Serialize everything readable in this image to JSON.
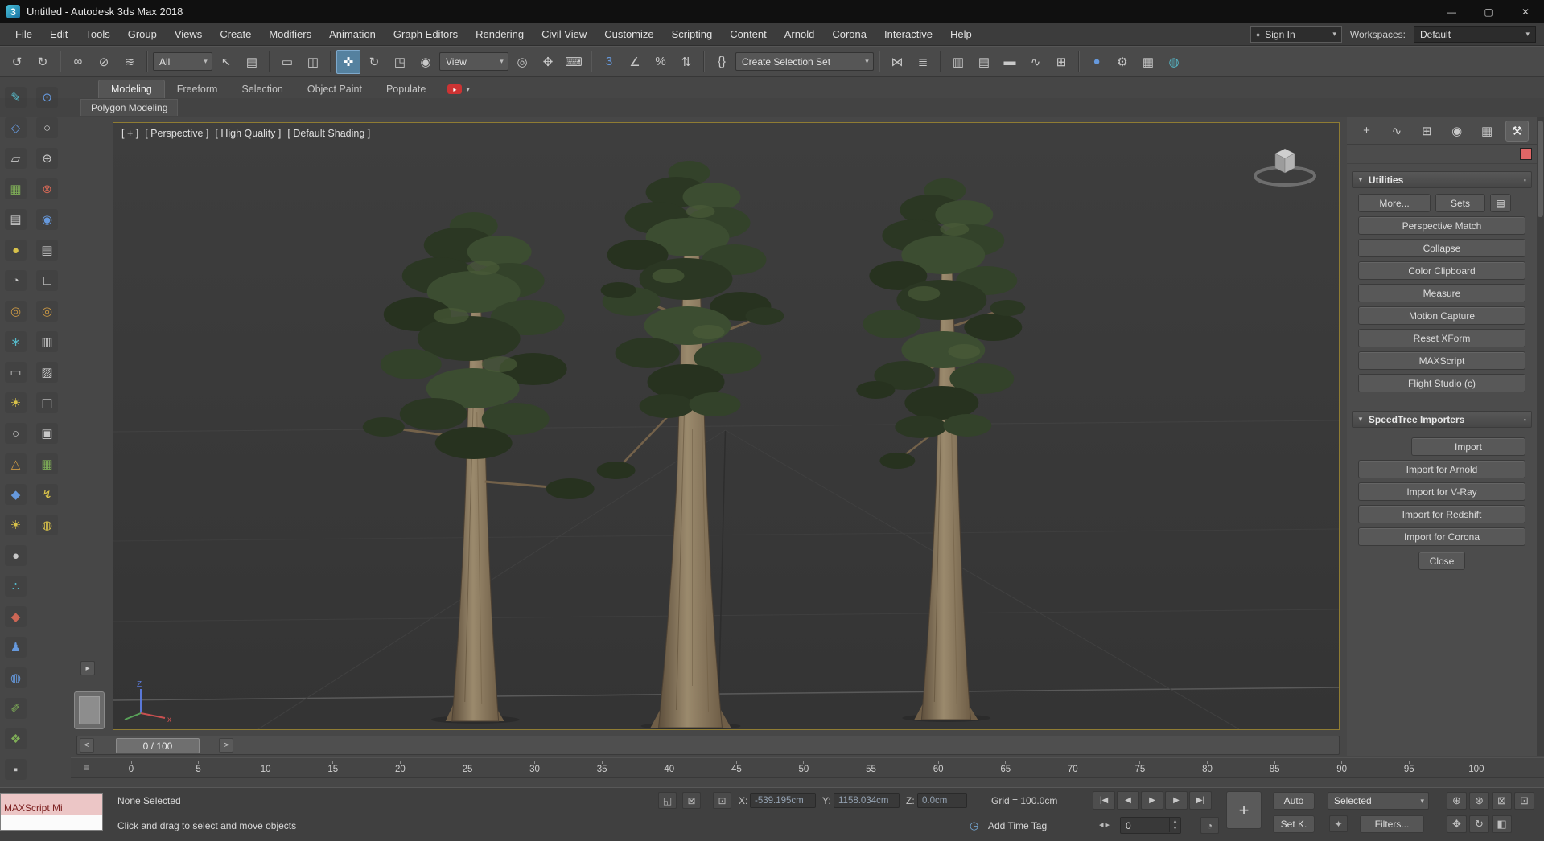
{
  "ui": {
    "caret": "▾",
    "spin_up": "▴",
    "spin_down": "▾",
    "slider_prev": "<",
    "slider_next": ">",
    "flyout": "▸",
    "ruler_icon": "≡",
    "rollout_open": "▼",
    "rollout_grip": "▪",
    "minimize": "—",
    "maximize": "▢",
    "close": "✕",
    "user": "●",
    "play": "▸",
    "logo": "3",
    "plus": "+"
  },
  "window": {
    "title": "Untitled - Autodesk 3ds Max 2018"
  },
  "menubar": {
    "items": [
      "File",
      "Edit",
      "Tools",
      "Group",
      "Views",
      "Create",
      "Modifiers",
      "Animation",
      "Graph Editors",
      "Rendering",
      "Civil View",
      "Customize",
      "Scripting",
      "Content",
      "Arnold",
      "Corona",
      "Interactive",
      "Help"
    ],
    "sign_in": "Sign In",
    "workspaces_label": "Workspaces:",
    "workspace_value": "Default"
  },
  "toolbar": {
    "filter_value": "All",
    "view_value": "View",
    "selection_set_placeholder": "Create Selection Set",
    "icons": [
      "↺",
      "↻",
      "∞",
      "⊘",
      "≋",
      "↖",
      "▤",
      "▭",
      "◫",
      "✜",
      "↻",
      "◳",
      "◉",
      "◎",
      "✥",
      "⌨",
      "3",
      "∠",
      "%",
      "⇅",
      "{}",
      "⋈",
      "≣",
      "▥",
      "▤",
      "▬",
      "∿",
      "⊞",
      "●",
      "⚙",
      "▦",
      "◍"
    ]
  },
  "ribbon": {
    "tabs": [
      "Modeling",
      "Freeform",
      "Selection",
      "Object Paint",
      "Populate"
    ],
    "sub_tab": "Polygon Modeling"
  },
  "left_toolbar": {
    "column_a": [
      "✎",
      "◇",
      "▱",
      "▦",
      "▤",
      "●",
      "◔",
      "◎",
      "∗",
      "▭",
      "☀",
      "○",
      "△",
      "◆",
      "☀",
      "●",
      "∴",
      "◆",
      "♟",
      "◍",
      "✐",
      "❖",
      "▪"
    ],
    "column_b": [
      "⊙",
      "○",
      "⊕",
      "⊗",
      "◉",
      "▤",
      "∟",
      "◎",
      "▥",
      "▨",
      "◫",
      "▣",
      "▦",
      "↯",
      "◍"
    ]
  },
  "viewport": {
    "segments": [
      "[ + ]",
      "[ Perspective ]",
      "[ High Quality ]",
      "[ Default Shading ]"
    ],
    "axis_x": "x",
    "axis_z": "Z"
  },
  "command_panel": {
    "tabs": [
      "+",
      "∿",
      "⊞",
      "◉",
      "▦",
      "⚒"
    ],
    "swatch_style": "background:#e06666",
    "utilities": {
      "title": "Utilities",
      "more": "More...",
      "sets": "Sets",
      "sets_icon": "▤",
      "buttons": [
        "Perspective Match",
        "Collapse",
        "Color Clipboard",
        "Measure",
        "Motion Capture",
        "Reset XForm",
        "MAXScript",
        "Flight Studio (c)"
      ]
    },
    "speedtree": {
      "title": "SpeedTree Importers",
      "import": "Import",
      "buttons": [
        "Import for Arnold",
        "Import for V-Ray",
        "Import for Redshift",
        "Import for Corona"
      ],
      "close": "Close"
    }
  },
  "timeline": {
    "frame_display": "0 / 100",
    "ticks": [
      "0",
      "5",
      "10",
      "15",
      "20",
      "25",
      "30",
      "35",
      "40",
      "45",
      "50",
      "55",
      "60",
      "65",
      "70",
      "75",
      "80",
      "85",
      "90",
      "95",
      "100"
    ]
  },
  "status": {
    "maxscript_label": "MAXScript Mi",
    "selection": "None Selected",
    "prompt": "Click and drag to select and move objects",
    "x_label": "X:",
    "x_value": "-539.195cm",
    "y_label": "Y:",
    "y_value": "1158.034cm",
    "z_label": "Z:",
    "z_value": "0.0cm",
    "grid_label": "Grid = 100.0cm",
    "add_time_tag": "Add Time Tag",
    "auto_key": "Auto",
    "selected": "Selected",
    "set_key": "Set K.",
    "filters": "Filters...",
    "frame_value": "0",
    "playback": [
      "|◀",
      "◀",
      "▶",
      "▶",
      "▶|"
    ],
    "nav_row1": [
      "⊕",
      "⊛",
      "⊠",
      "⊡"
    ],
    "nav_row2": [
      "✥",
      "↻",
      "◧"
    ],
    "icons": {
      "isolate": "◱",
      "lock": "⊠",
      "absolute": "⊡",
      "time_tag": "◷",
      "time_config": "◔",
      "key_filter": "✦",
      "frame_prev": "◂",
      "frame_next": "▸"
    }
  }
}
